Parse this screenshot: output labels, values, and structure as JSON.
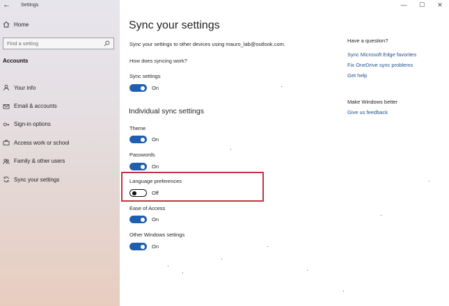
{
  "window": {
    "title": "Settings",
    "controls": [
      "—",
      "☐",
      "✕"
    ]
  },
  "sidebar": {
    "home_label": "Home",
    "search_placeholder": "Find a setting",
    "section_label": "Accounts",
    "items": [
      {
        "label": "Your info",
        "icon": "person-icon"
      },
      {
        "label": "Email & accounts",
        "icon": "mail-icon"
      },
      {
        "label": "Sign-in options",
        "icon": "key-icon"
      },
      {
        "label": "Access work or school",
        "icon": "briefcase-icon"
      },
      {
        "label": "Family & other users",
        "icon": "people-icon"
      },
      {
        "label": "Sync your settings",
        "icon": "sync-icon"
      }
    ]
  },
  "main": {
    "title": "Sync your settings",
    "intro": "Sync your settings to other devices using mauro_lab@outlook.com.",
    "how_link": "How does syncing work?",
    "sync_settings": {
      "label": "Sync settings",
      "state": "On"
    },
    "individual_heading": "Individual sync settings",
    "settings": [
      {
        "label": "Theme",
        "state": "On"
      },
      {
        "label": "Passwords",
        "state": "On"
      },
      {
        "label": "Language preferences",
        "state": "Off"
      },
      {
        "label": "Ease of Access",
        "state": "On"
      },
      {
        "label": "Other Windows settings",
        "state": "On"
      }
    ]
  },
  "help": {
    "question_heading": "Have a question?",
    "links": [
      "Sync Microsoft Edge favorites",
      "Fix OneDrive sync problems",
      "Get help"
    ],
    "better_heading": "Make Windows better",
    "feedback_link": "Give us feedback"
  },
  "colors": {
    "toggle_on": "#1f5fb0",
    "highlight_border": "#c0323e",
    "link": "#1e4f8a"
  }
}
